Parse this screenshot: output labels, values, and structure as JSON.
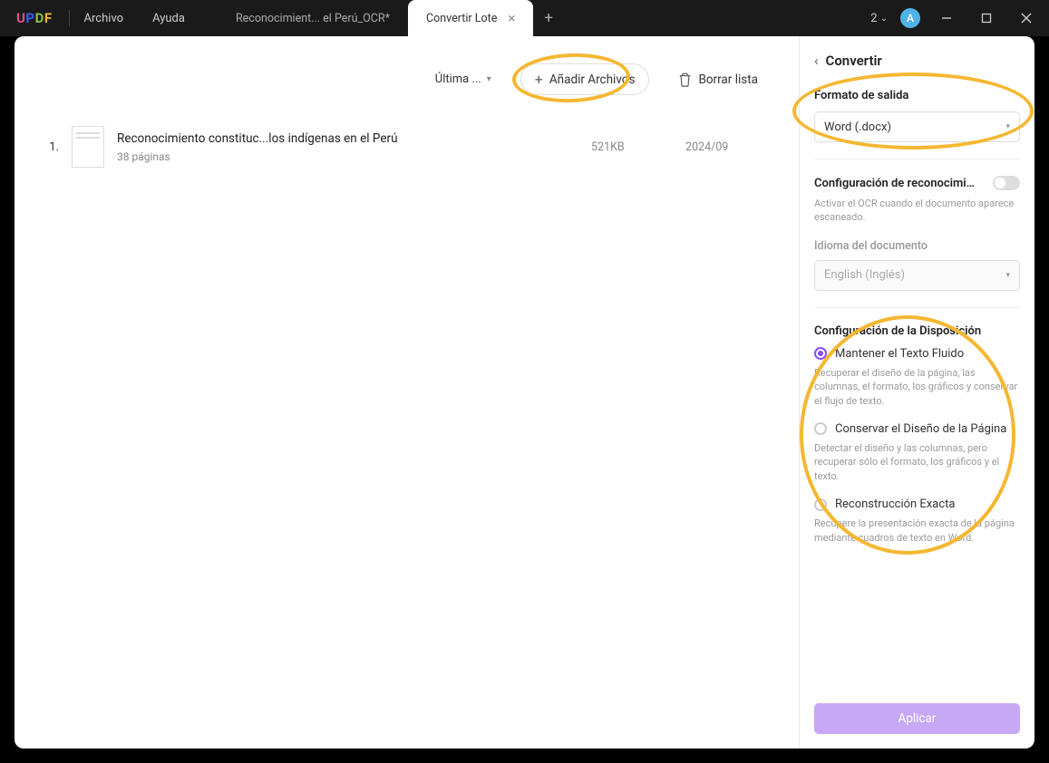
{
  "app": {
    "logo": "UPDF",
    "counter": "2",
    "avatar_letter": "A"
  },
  "menu": {
    "file": "Archivo",
    "help": "Ayuda"
  },
  "tabs": {
    "inactive": "Reconocimient... el Perú_OCR*",
    "active": "Convertir Lote"
  },
  "toolbar": {
    "sort": "Última ...",
    "add": "Añadir Archivos",
    "delete": "Borrar lista"
  },
  "files": [
    {
      "num": "1.",
      "name": "Reconocimiento constituc...los indígenas en el Perú",
      "pages": "38 páginas",
      "size": "521KB",
      "date": "2024/09"
    }
  ],
  "sidebar": {
    "back_title": "Convertir",
    "format_label": "Formato de salida",
    "format_value": "Word (.docx)",
    "ocr_label": "Configuración de reconocimient...",
    "ocr_help": "Activar el OCR cuando el documento aparece escaneado.",
    "lang_label": "Idioma del documento",
    "lang_value": "English (Inglés)",
    "layout_label": "Configuración de la Disposición",
    "radios": [
      {
        "label": "Mantener el Texto Fluido",
        "desc": "Recuperar el diseño de la página, las columnas, el formato, los gráficos y conservar el flujo de texto.",
        "checked": true
      },
      {
        "label": "Conservar el Diseño de la Página",
        "desc": "Detectar el diseño y las columnas, pero recuperar sólo el formato, los gráficos y el texto.",
        "checked": false
      },
      {
        "label": "Reconstrucción Exacta",
        "desc": "Recupere la presentación exacta de la página mediante cuadros de texto en Word.",
        "checked": false
      }
    ],
    "apply": "Aplicar"
  }
}
